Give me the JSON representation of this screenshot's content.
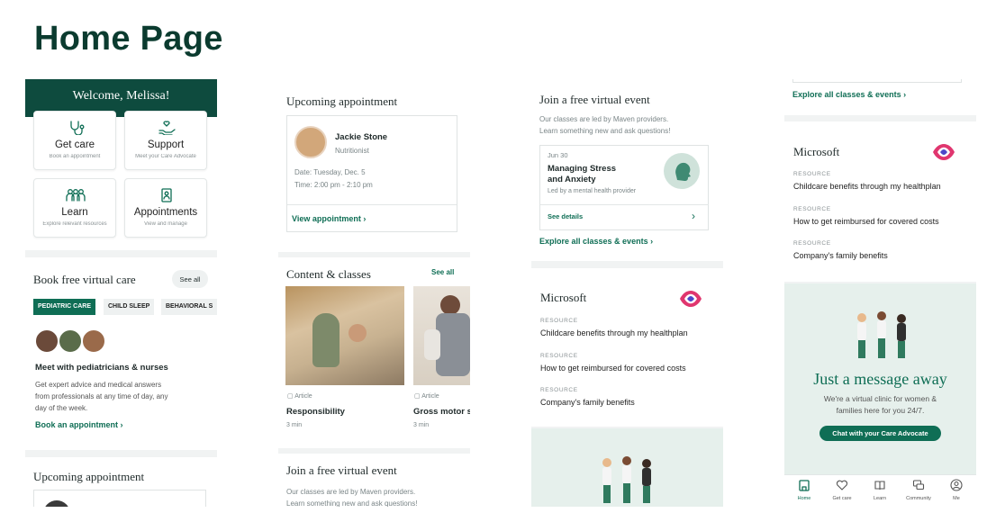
{
  "page_title": "Home Page",
  "col1": {
    "welcome": "Welcome, Melissa!",
    "tiles": [
      {
        "title": "Get care",
        "sub": "Book an appointment"
      },
      {
        "title": "Support",
        "sub": "Meet your Care Advocate"
      },
      {
        "title": "Learn",
        "sub": "Explore relevant resources"
      },
      {
        "title": "Appointments",
        "sub": "View and manage"
      }
    ],
    "book_title": "Book free virtual care",
    "see_all": "See all",
    "chips": [
      "PEDIATRIC CARE",
      "CHILD SLEEP",
      "BEHAVIORAL S"
    ],
    "meet_title": "Meet with pediatricians & nurses",
    "meet_desc": [
      "Get expert advice and medical answers",
      "from professionals at any time of day, any",
      "day of the week."
    ],
    "book_link": "Book an appointment",
    "upcoming_title": "Upcoming appointment"
  },
  "col2": {
    "upcoming_title": "Upcoming appointment",
    "provider_name": "Jackie Stone",
    "provider_role": "Nutritionist",
    "date": "Date: Tuesday, Dec. 5",
    "time": "Time: 2:00 pm - 2:10 pm",
    "view_link": "View appointment",
    "content_title": "Content & classes",
    "see_all": "See all",
    "items": [
      {
        "kind": "Article",
        "title": "Responsibility",
        "duration": "3 min"
      },
      {
        "kind": "Article",
        "title": "Gross motor s",
        "duration": "3 min"
      }
    ],
    "event_title": "Join a free virtual event",
    "event_desc": [
      "Our classes are led by Maven providers.",
      "Learn something new and ask questions!"
    ]
  },
  "col3": {
    "event_title": "Join a free virtual event",
    "event_desc": [
      "Our classes are led by Maven providers.",
      "Learn something new and ask questions!"
    ],
    "event_date": "Jun 30",
    "event_name": [
      "Managing Stress",
      "and Anxiety"
    ],
    "event_led": "Led by a mental health provider",
    "see_details": "See details",
    "explore_link": "Explore all classes & events",
    "company": "Microsoft",
    "resources": [
      {
        "label": "RESOURCE",
        "text": "Childcare benefits through my healthplan"
      },
      {
        "label": "RESOURCE",
        "text": "How to get reimbursed for covered costs"
      },
      {
        "label": "RESOURCE",
        "text": "Company's family benefits"
      }
    ]
  },
  "col4": {
    "explore_link": "Explore all classes & events",
    "company": "Microsoft",
    "resources": [
      {
        "label": "RESOURCE",
        "text": "Childcare benefits through my healthplan"
      },
      {
        "label": "RESOURCE",
        "text": "How to get reimbursed for covered costs"
      },
      {
        "label": "RESOURCE",
        "text": "Company's family benefits"
      }
    ],
    "message_title": "Just a message away",
    "message_desc": [
      "We're a virtual clinic for women &",
      "families here for you 24/7."
    ],
    "chat_button": "Chat with your Care Advocate",
    "nav": [
      "Home",
      "Get care",
      "Learn",
      "Community",
      "Me"
    ]
  },
  "colors": {
    "brand_dark": "#0e4b3e",
    "brand": "#0f6e55",
    "mint_bg": "#e6f0ec",
    "chip_bg": "#eef1f1"
  }
}
